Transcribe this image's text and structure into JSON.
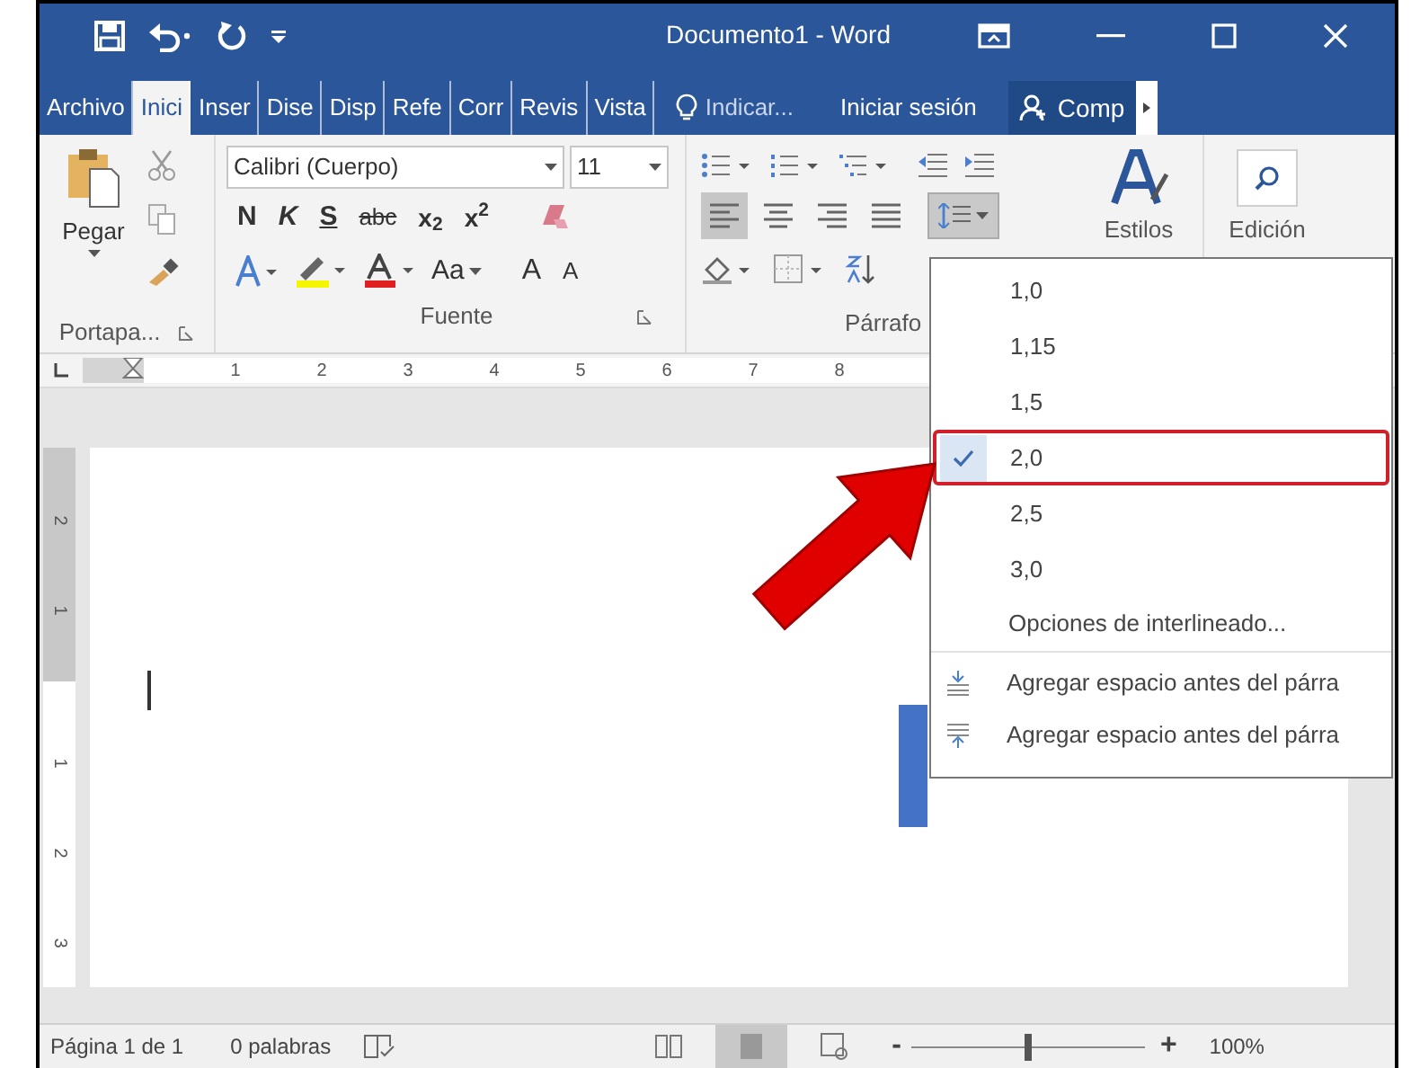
{
  "title_bar": {
    "title": "Documento1 - Word"
  },
  "tabs": [
    {
      "label": "Archivo",
      "selected": false
    },
    {
      "label": "Inici",
      "selected": true
    },
    {
      "label": "Inser",
      "selected": false
    },
    {
      "label": "Dise",
      "selected": false
    },
    {
      "label": "Disp",
      "selected": false
    },
    {
      "label": "Refe",
      "selected": false
    },
    {
      "label": "Corr",
      "selected": false
    },
    {
      "label": "Revis",
      "selected": false
    },
    {
      "label": "Vista",
      "selected": false
    }
  ],
  "tell_me": "Indicar...",
  "sign_in": "Iniciar sesión",
  "share": "Comp",
  "ribbon": {
    "clipboard": {
      "paste": "Pegar",
      "label": "Portapa..."
    },
    "font": {
      "name": "Calibri (Cuerpo)",
      "size": "11",
      "label": "Fuente",
      "case": "Aa",
      "grow": "A",
      "shrink": "A",
      "buttons": [
        {
          "kind": "bold",
          "label": "N"
        },
        {
          "kind": "italic",
          "label": "K"
        },
        {
          "kind": "underline",
          "label": "S"
        },
        {
          "kind": "strike",
          "label": "abc"
        },
        {
          "kind": "plain",
          "label": "x$_{2}$"
        },
        {
          "kind": "plain",
          "label": "x$^{2}$"
        }
      ]
    },
    "paragraph": {
      "label": "Párrafo",
      "align": [
        {
          "kind": "left",
          "selected": true
        },
        {
          "kind": "center",
          "selected": false
        },
        {
          "kind": "right",
          "selected": false
        },
        {
          "kind": "justify",
          "selected": false
        }
      ]
    },
    "styles": {
      "label": "Estilos"
    },
    "editing": {
      "label": "Edición"
    }
  },
  "ruler": {
    "numbers": [
      "1",
      "2",
      "3",
      "4",
      "5",
      "6",
      "7",
      "8"
    ]
  },
  "vertical_ruler": {
    "numbers": [
      "2",
      "1",
      "1",
      "2",
      "3"
    ]
  },
  "line_spacing_menu": [
    {
      "kind": "spacing",
      "label": "1,0",
      "selected": false
    },
    {
      "kind": "spacing",
      "label": "1,15",
      "selected": false
    },
    {
      "kind": "spacing",
      "label": "1,5",
      "selected": false
    },
    {
      "kind": "spacing",
      "label": "2,0",
      "selected": true
    },
    {
      "kind": "spacing",
      "label": "2,5",
      "selected": false
    },
    {
      "kind": "spacing",
      "label": "3,0",
      "selected": false
    },
    {
      "kind": "options",
      "label": "Opciones de interlineado..."
    },
    {
      "kind": "add_before",
      "label": "Agregar espacio antes del párra"
    },
    {
      "kind": "add_after",
      "label": "Agregar espacio antes del párra"
    }
  ],
  "status_bar": {
    "page": "Página 1 de 1",
    "words": "0 palabras",
    "views": [
      {
        "kind": "read",
        "selected": false
      },
      {
        "kind": "print",
        "selected": true
      },
      {
        "kind": "web",
        "selected": false
      }
    ],
    "zoom_out": "-",
    "zoom_in": "+",
    "zoom": "100%",
    "zoom_slider": {
      "level": 0.5
    }
  }
}
